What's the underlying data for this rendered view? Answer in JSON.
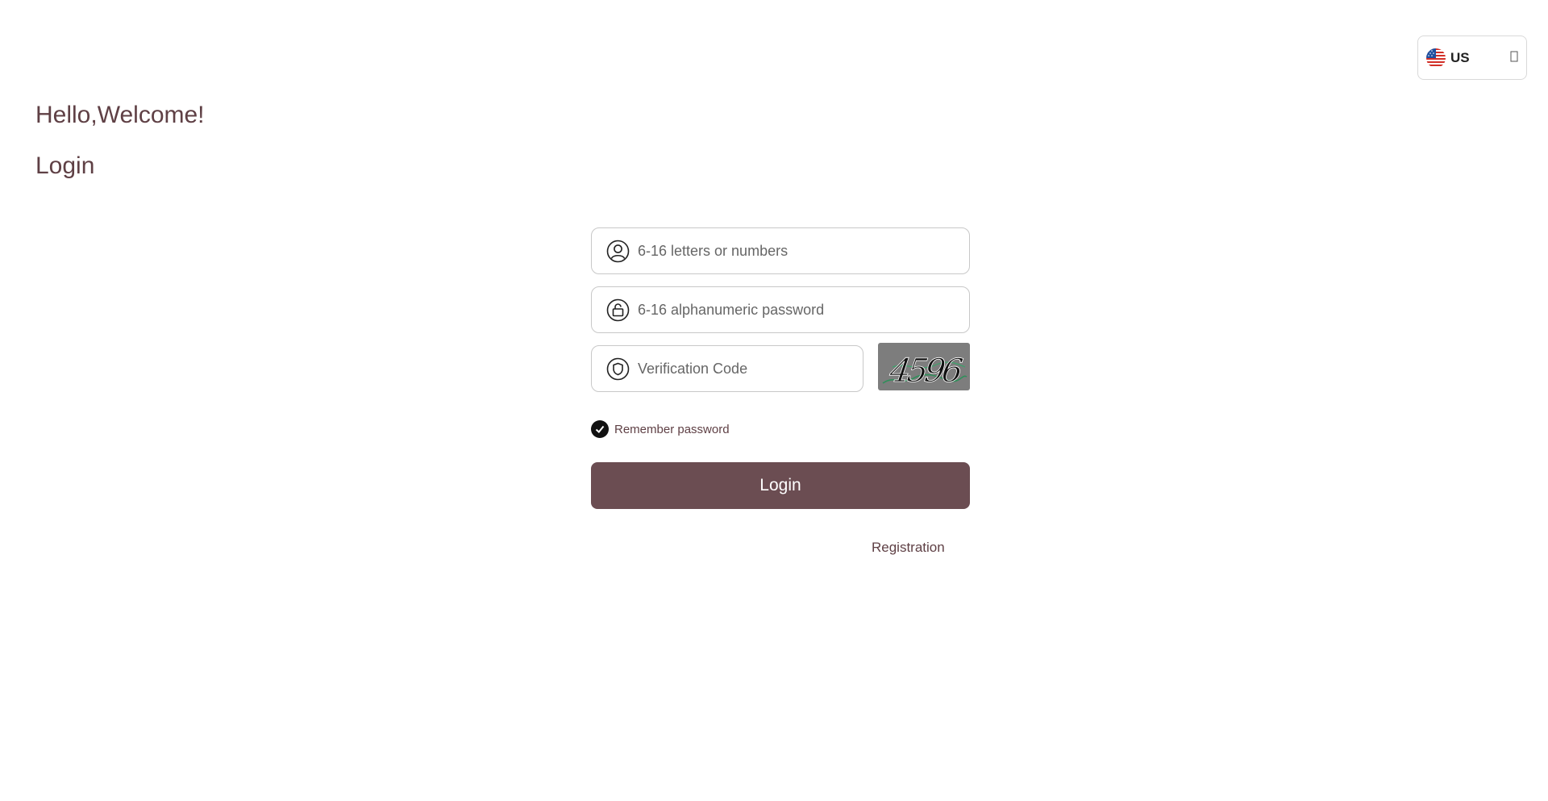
{
  "language": {
    "code": "US",
    "flag_icon": "us-flag-icon",
    "chevron_icon": "chevron-down-icon"
  },
  "greeting": "Hello,Welcome!",
  "heading": "Login",
  "form": {
    "username": {
      "placeholder": "6-16 letters or numbers",
      "value": "",
      "icon": "user-icon"
    },
    "password": {
      "placeholder": "6-16 alphanumeric password",
      "value": "",
      "icon": "lock-icon"
    },
    "verification": {
      "placeholder": "Verification Code",
      "value": "",
      "icon": "shield-icon"
    },
    "captcha_text": "4596",
    "remember_label": "Remember password",
    "remember_checked": true,
    "submit_label": "Login",
    "register_label": "Registration"
  },
  "colors": {
    "accent": "#6b4d52",
    "text": "#5f4045",
    "captcha_bg": "#7d7d7d"
  }
}
